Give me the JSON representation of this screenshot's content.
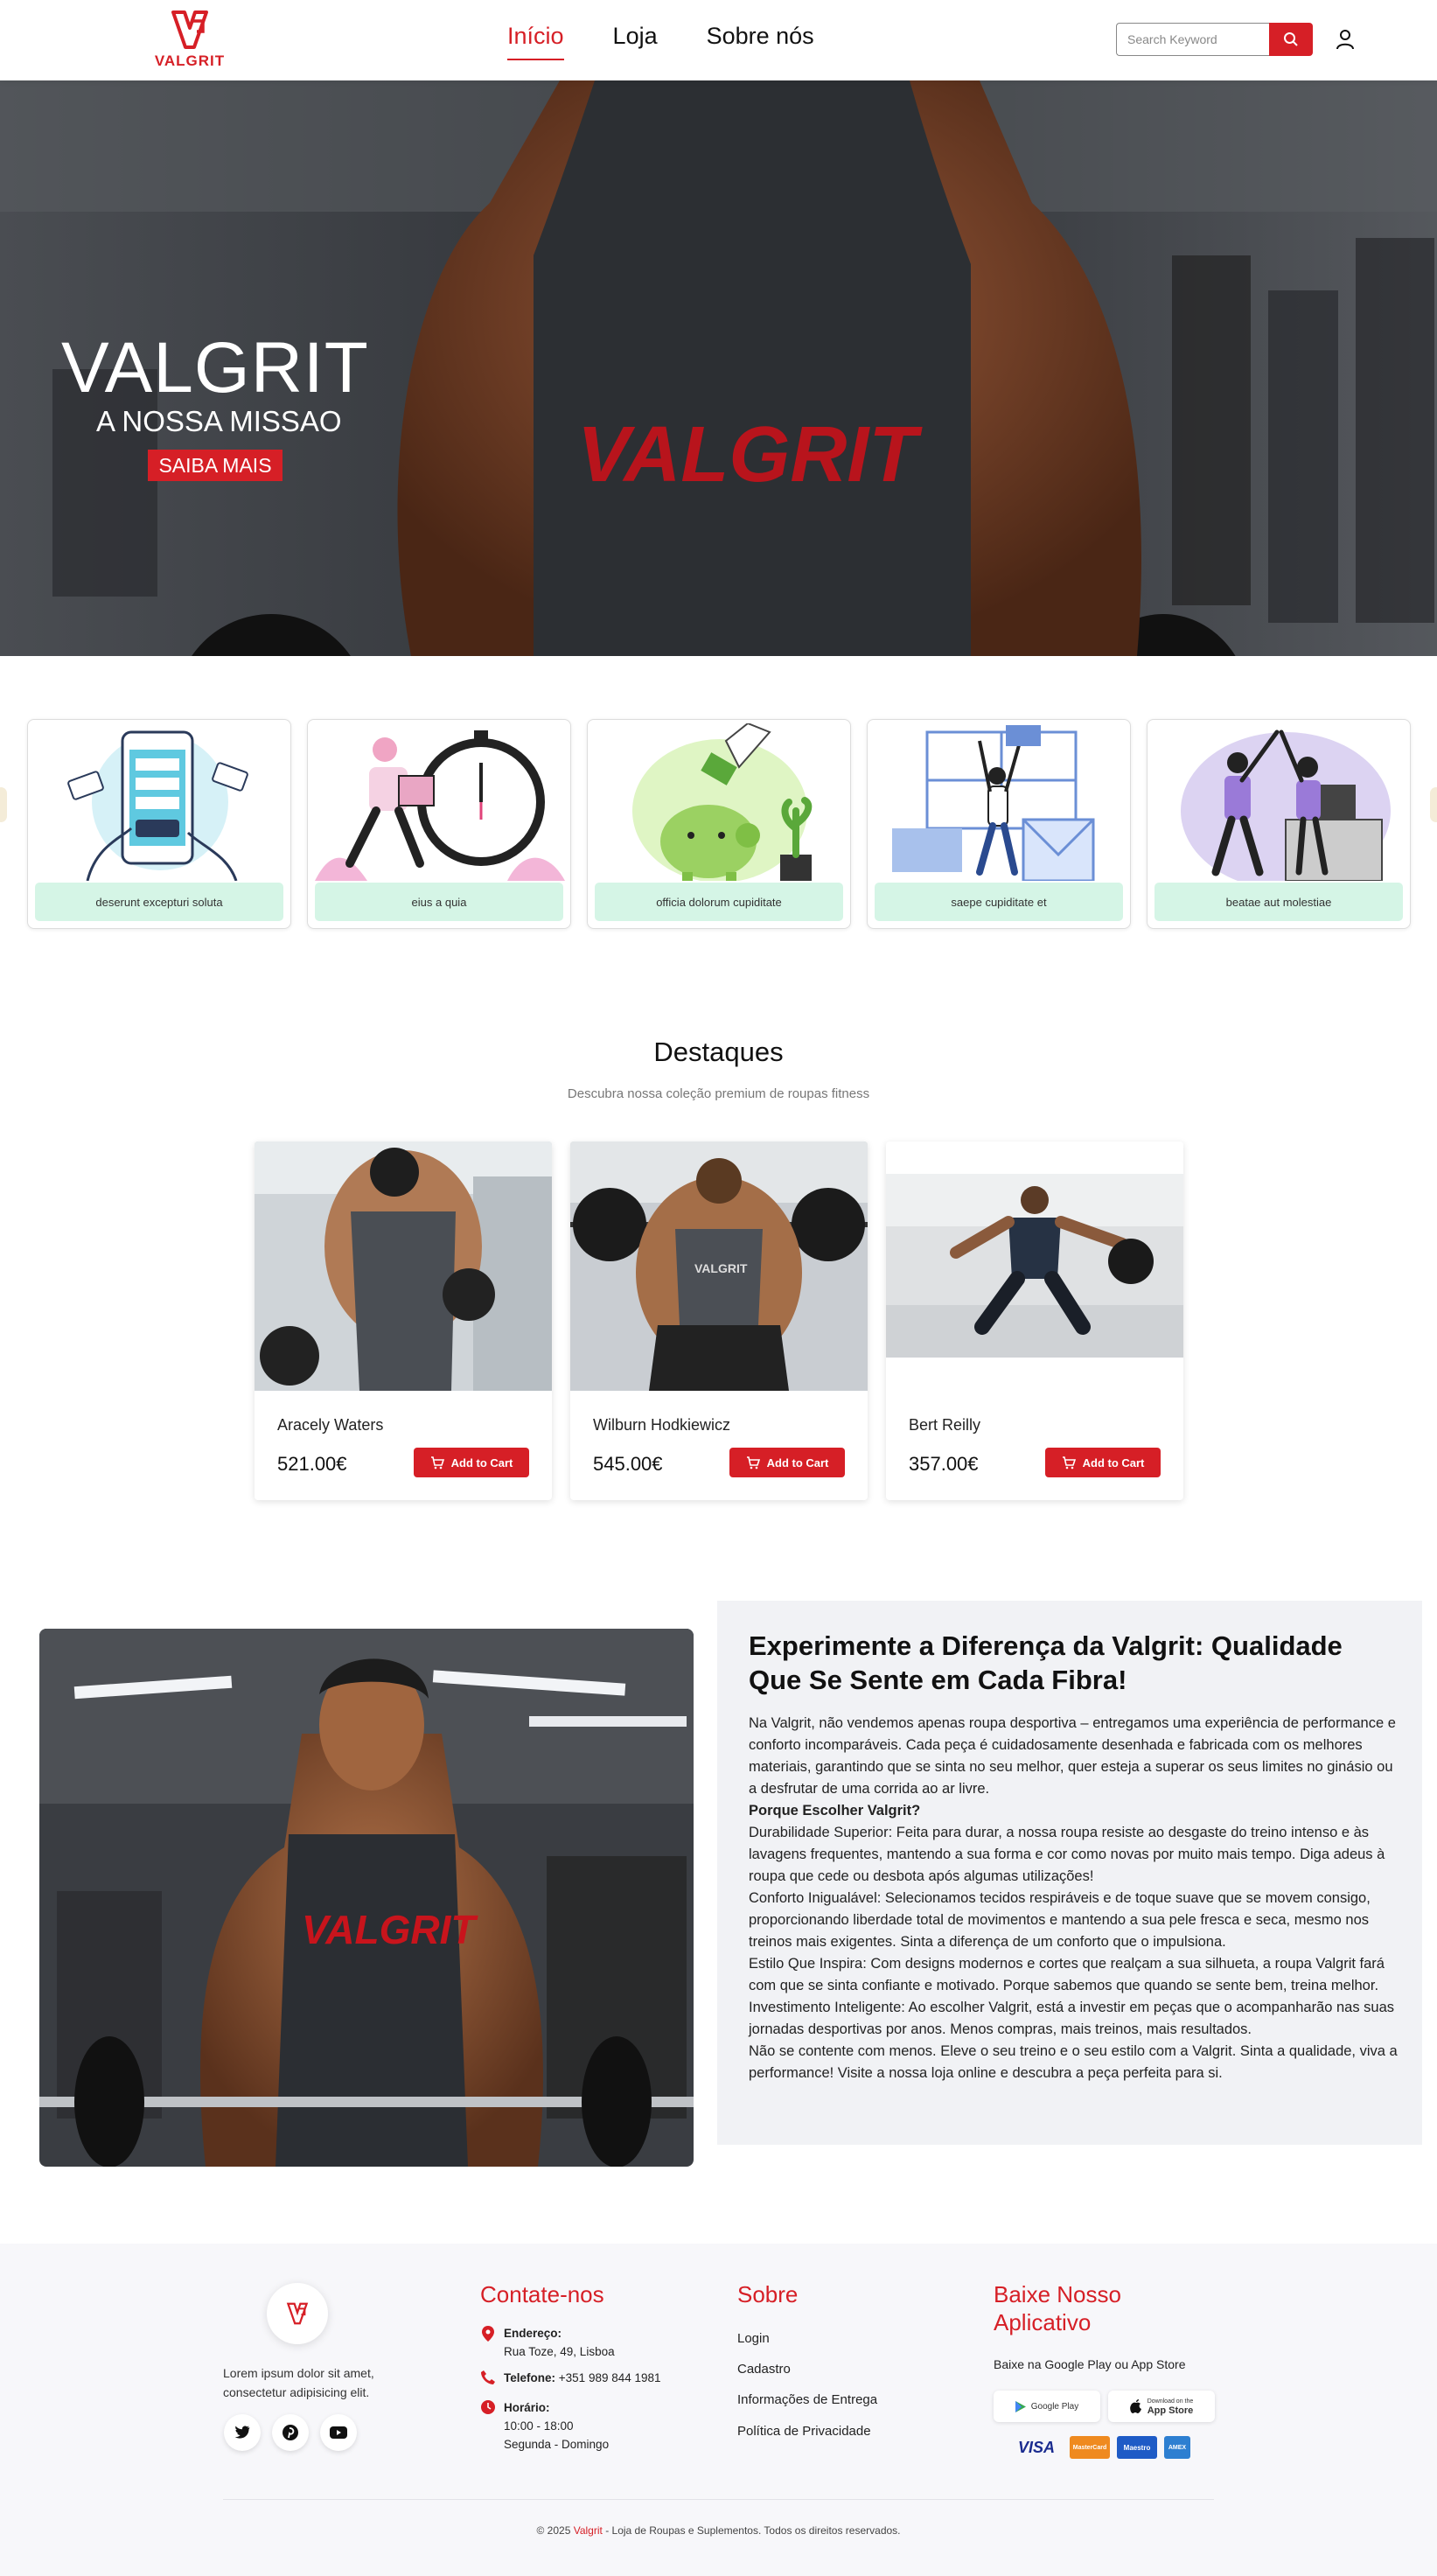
{
  "nav": {
    "logo_text": "VALGRIT",
    "menu": [
      {
        "label": "Início",
        "active": true
      },
      {
        "label": "Loja",
        "active": false
      },
      {
        "label": "Sobre nós",
        "active": false
      }
    ],
    "search_placeholder": "Search Keyword",
    "search_icon": "search-icon",
    "user_icon": "user-icon"
  },
  "hero": {
    "title": "VALGRIT",
    "subtitle": "A NOSSA MISSAO",
    "button": "SAIBA MAIS",
    "shirt_text": "VALGRIT"
  },
  "categories": [
    {
      "label": "deserunt excepturi soluta",
      "illustration": "mobile-payment"
    },
    {
      "label": "eius a quia",
      "illustration": "delivery-clock"
    },
    {
      "label": "officia dolorum cupiditate",
      "illustration": "piggy-bank"
    },
    {
      "label": "saepe cupiditate et",
      "illustration": "mail-celebration"
    },
    {
      "label": "beatae aut molestiae",
      "illustration": "high-five"
    }
  ],
  "featured": {
    "title": "Destaques",
    "subtitle": "Descubra nossa coleção premium de roupas fitness",
    "products": [
      {
        "name": "Aracely Waters",
        "price": "521.00€",
        "button": "Add to Cart"
      },
      {
        "name": "Wilburn Hodkiewicz",
        "price": "545.00€",
        "button": "Add to Cart"
      },
      {
        "name": "Bert Reilly",
        "price": "357.00€",
        "button": "Add to Cart"
      }
    ]
  },
  "about": {
    "heading": "Experimente a Diferença da Valgrit: Qualidade Que Se Sente em Cada Fibra!",
    "intro": "Na Valgrit, não vendemos apenas roupa desportiva – entregamos uma experiência de performance e conforto incomparáveis. Cada peça é cuidadosamente desenhada e fabricada com os melhores materiais, garantindo que se sinta no seu melhor, quer esteja a superar os seus limites no ginásio ou a desfrutar de uma corrida ao ar livre.",
    "why": "Porque Escolher Valgrit?",
    "p1": "Durabilidade Superior: Feita para durar, a nossa roupa resiste ao desgaste do treino intenso e às lavagens frequentes, mantendo a sua forma e cor como novas por muito mais tempo. Diga adeus à roupa que cede ou desbota após algumas utilizações!",
    "p2": "Conforto Inigualável: Selecionamos tecidos respiráveis e de toque suave que se movem consigo, proporcionando liberdade total de movimentos e mantendo a sua pele fresca e seca, mesmo nos treinos mais exigentes. Sinta a diferença de um conforto que o impulsiona.",
    "p3": "Estilo Que Inspira: Com designs modernos e cortes que realçam a sua silhueta, a roupa Valgrit fará com que se sinta confiante e motivado. Porque sabemos que quando se sente bem, treina melhor.",
    "p4": "Investimento Inteligente: Ao escolher Valgrit, está a investir em peças que o acompanharão nas suas jornadas desportivas por anos. Menos compras, mais treinos, mais resultados.",
    "p5": "Não se contente com menos. Eleve o seu treino e o seu estilo com a Valgrit. Sinta a qualidade, viva a performance! Visite a nossa loja online e descubra a peça perfeita para si."
  },
  "footer": {
    "description": "Lorem ipsum dolor sit amet, consectetur adipisicing elit.",
    "social": [
      "twitter-icon",
      "pinterest-icon",
      "youtube-icon"
    ],
    "contact": {
      "title": "Contate-nos",
      "address_label": "Endereço:",
      "address": "Rua Toze, 49, Lisboa",
      "phone_label": "Telefone:",
      "phone": "+351 989 844 1981",
      "hours_label": "Horário:",
      "hours": "10:00 - 18:00",
      "days": "Segunda - Domingo"
    },
    "about": {
      "title": "Sobre",
      "links": [
        "Login",
        "Cadastro",
        "Informações de Entrega",
        "Política de Privacidade"
      ]
    },
    "app": {
      "title": "Baixe Nosso Aplicativo",
      "subtitle": "Baixe na Google Play ou App Store",
      "google": "Google Play",
      "apple_small": "Download on the",
      "apple": "App Store",
      "payments": [
        "VISA",
        "MasterCard",
        "Maestro",
        "AMEX"
      ]
    },
    "copyright_pre": "© 2025",
    "copyright_brand": "Valgrit",
    "copyright_post": "- Loja de Roupas e Suplementos. Todos os direitos reservados."
  },
  "colors": {
    "brand_red": "#d61f26",
    "mint": "#d5f5e6"
  }
}
